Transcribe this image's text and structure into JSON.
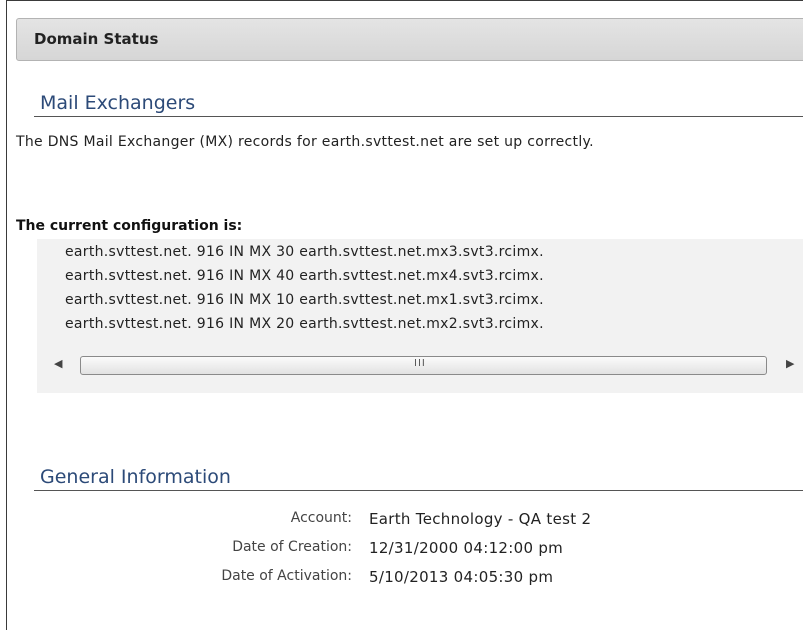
{
  "panel": {
    "title": "Domain Status"
  },
  "mail_exchangers": {
    "heading": "Mail Exchangers",
    "description": "The DNS Mail Exchanger (MX) records for earth.svttest.net are set up correctly.",
    "config_label": "The current configuration is:",
    "records": [
      "earth.svttest.net. 916 IN MX 30 earth.svttest.net.mx3.svt3.rcimx.",
      "earth.svttest.net. 916 IN MX 40 earth.svttest.net.mx4.svt3.rcimx.",
      "earth.svttest.net. 916 IN MX 10 earth.svttest.net.mx1.svt3.rcimx.",
      "earth.svttest.net. 916 IN MX 20 earth.svttest.net.mx2.svt3.rcimx."
    ],
    "scrollbar": {
      "left_arrow": "◀",
      "right_arrow": "▶",
      "grip": "III"
    }
  },
  "general_information": {
    "heading": "General Information",
    "rows": [
      {
        "label": "Account:",
        "value": "Earth Technology - QA test 2"
      },
      {
        "label": "Date of Creation:",
        "value": "12/31/2000 04:12:00 pm"
      },
      {
        "label": "Date of Activation:",
        "value": "5/10/2013 04:05:30 pm"
      }
    ]
  }
}
